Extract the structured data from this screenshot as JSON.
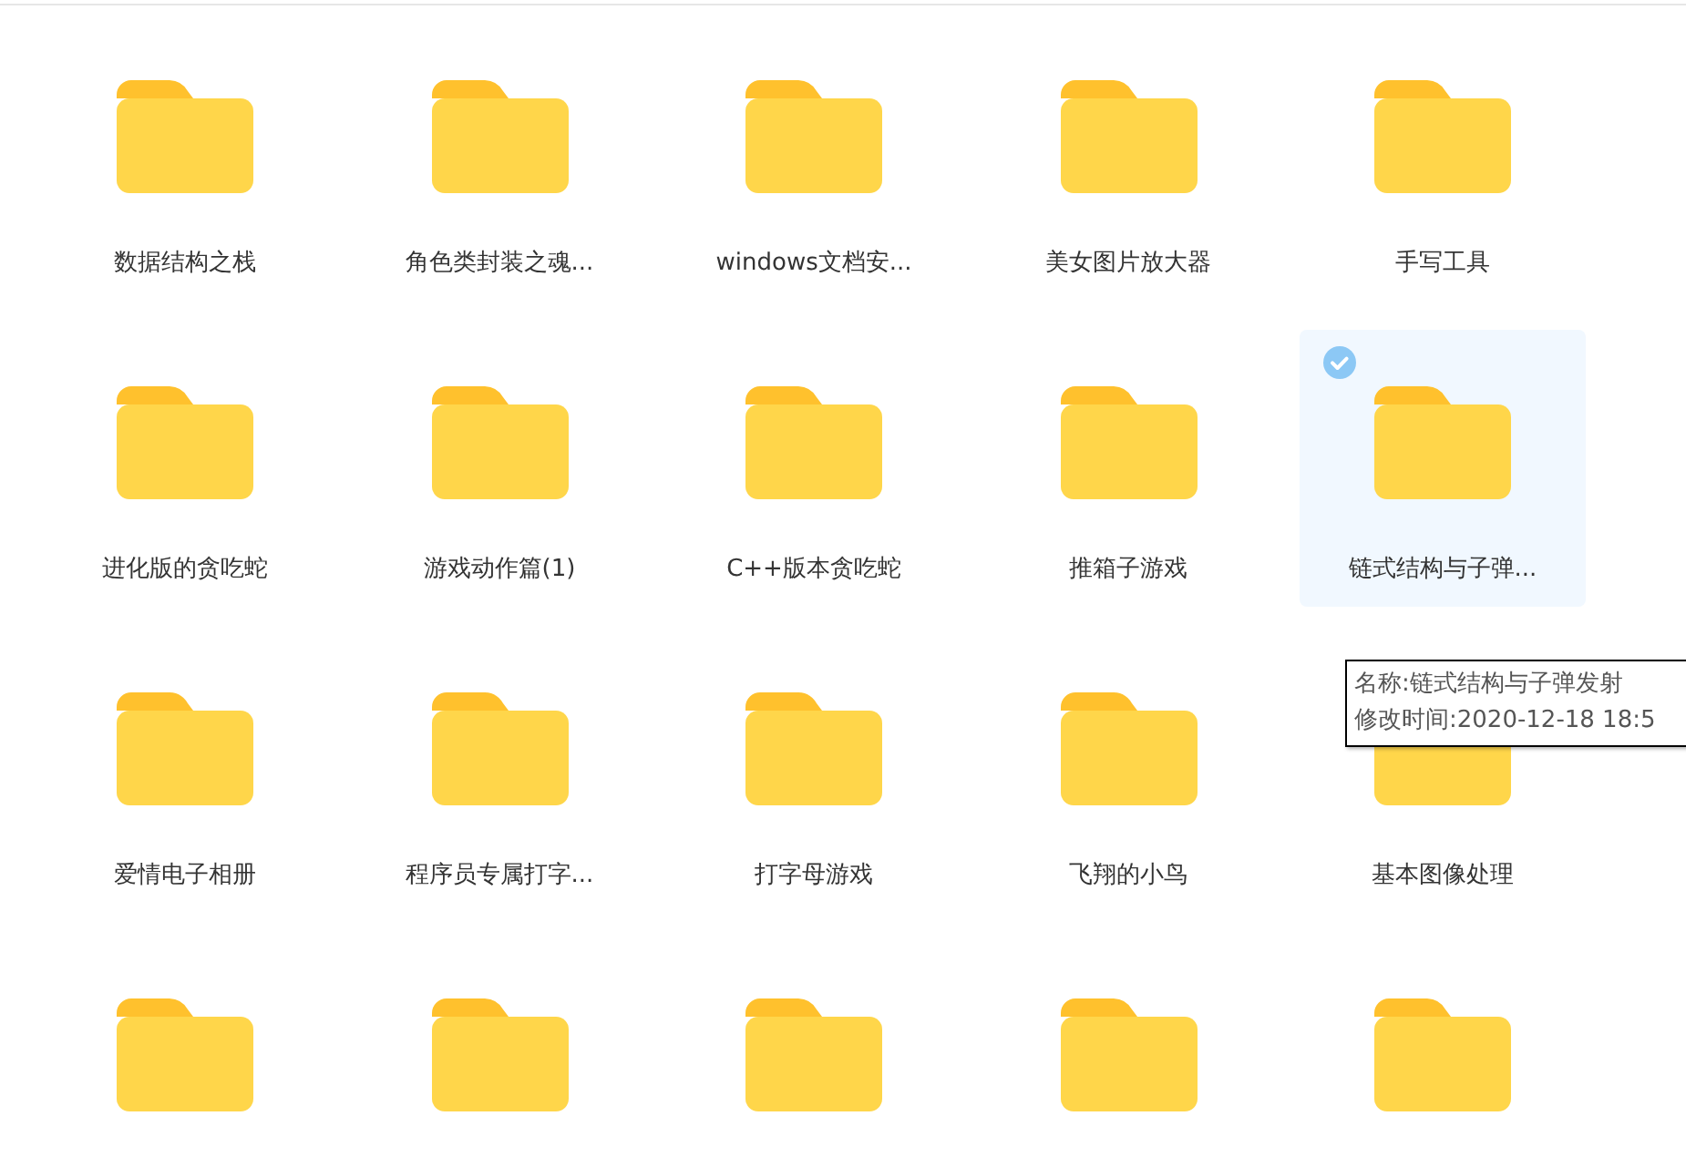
{
  "folders": [
    {
      "name": "数据结构之栈",
      "selected": false
    },
    {
      "name": "角色类封装之魂...",
      "selected": false
    },
    {
      "name": "windows文档安...",
      "selected": false
    },
    {
      "name": "美女图片放大器",
      "selected": false
    },
    {
      "name": "手写工具",
      "selected": false
    },
    {
      "name": "进化版的贪吃蛇",
      "selected": false
    },
    {
      "name": "游戏动作篇(1)",
      "selected": false
    },
    {
      "name": "C++版本贪吃蛇",
      "selected": false
    },
    {
      "name": "推箱子游戏",
      "selected": false
    },
    {
      "name": "链式结构与子弹...",
      "selected": true
    },
    {
      "name": "爱情电子相册",
      "selected": false
    },
    {
      "name": "程序员专属打字...",
      "selected": false
    },
    {
      "name": "打字母游戏",
      "selected": false
    },
    {
      "name": "飞翔的小鸟",
      "selected": false
    },
    {
      "name": "基本图像处理",
      "selected": false
    },
    {
      "selected": false
    },
    {
      "selected": false
    },
    {
      "selected": false
    },
    {
      "selected": false
    },
    {
      "selected": false
    }
  ],
  "tooltip": {
    "name_line": "名称:链式结构与子弹发射",
    "time_line": "修改时间:2020-12-18 18:5"
  }
}
